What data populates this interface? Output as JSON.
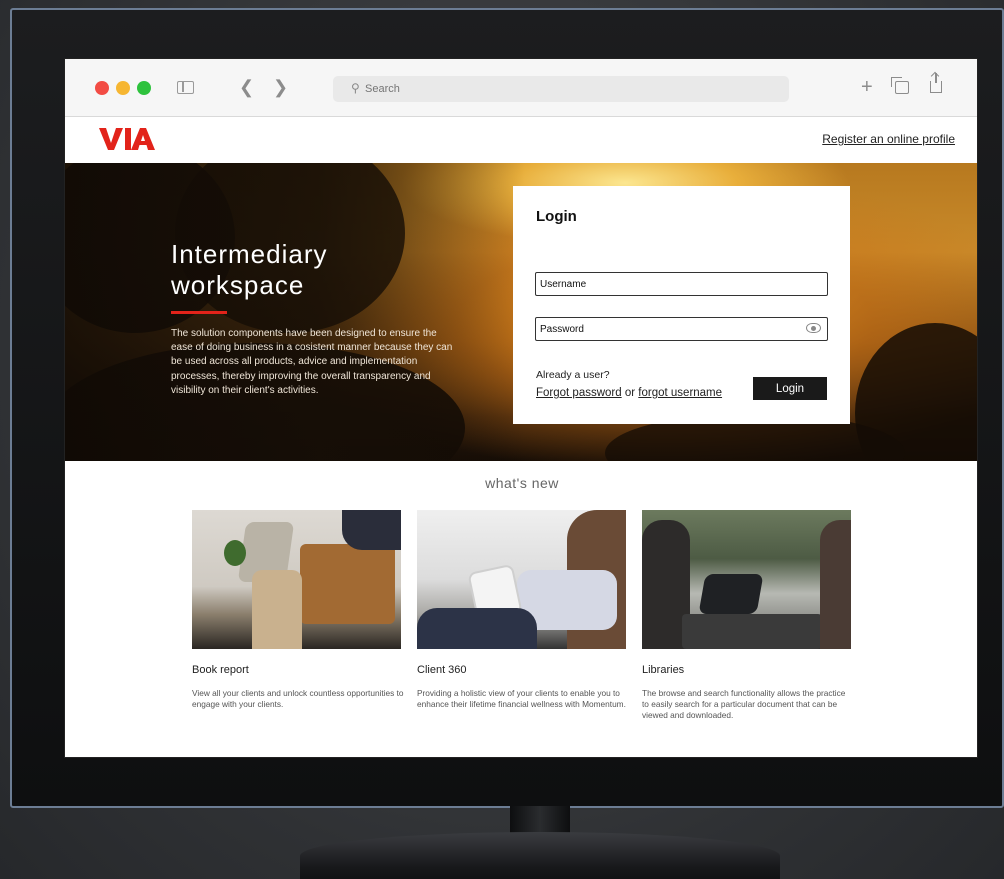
{
  "browser": {
    "search_placeholder": "Search",
    "icons": [
      "sidebar-icon",
      "back-icon",
      "forward-icon",
      "search-icon",
      "plus-icon",
      "tabs-icon",
      "share-icon"
    ],
    "dot_colors": [
      "#f24c44",
      "#f6b632",
      "#2ec23d"
    ]
  },
  "header": {
    "logo_text": "VIA",
    "logo_color": "#e2231a",
    "register_link": "Register an online profile"
  },
  "hero": {
    "title_line1": "Intermediary",
    "title_line2": "workspace",
    "accent_color": "#e2231a",
    "body": "The solution components have been designed to ensure the ease of doing business in a cosistent manner because they can be used across all products, advice and implementation processes, thereby improving the overall transparency and visibility on their client's activities."
  },
  "login": {
    "title": "Login",
    "username_placeholder": "Username",
    "password_placeholder": "Password",
    "already_user": "Already a user?",
    "forgot_password": "Forgot password",
    "or": "or",
    "forgot_username": "forgot username",
    "button_label": "Login"
  },
  "whats_new": {
    "heading": "what's new",
    "cards": [
      {
        "title": "Book report",
        "description": "View all your clients and unlock countless opportunities to engage with your clients."
      },
      {
        "title": "Client 360",
        "description": "Providing a holistic view of your clients to enable you to enhance their lifetime financial wellness with Momentum."
      },
      {
        "title": "Libraries",
        "description": "The browse and search functionality allows the practice to easily search for a particular document that can be viewed and downloaded."
      }
    ]
  }
}
